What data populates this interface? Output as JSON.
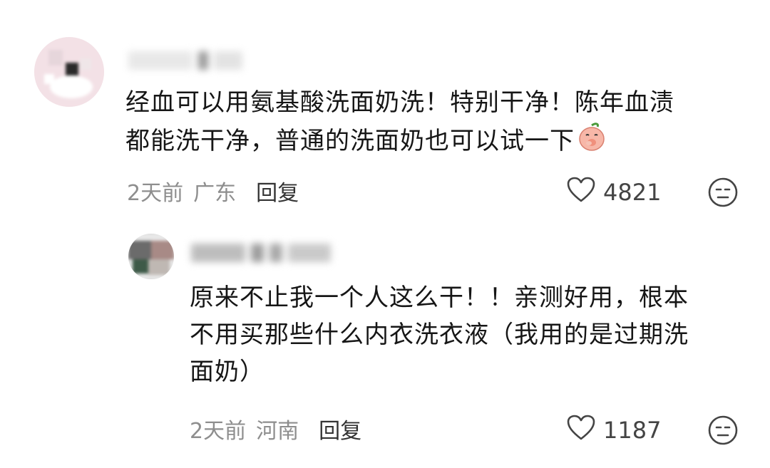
{
  "comments": [
    {
      "text_line1": "经血可以用氨基酸洗面奶洗！特别干净！陈年血渍",
      "text_line2": "都能洗干净，普通的洗面奶也可以试一下",
      "inline_emoji": "peach-cover-mouth-emoji",
      "time": "2天前",
      "location": "广东",
      "reply_label": "回复",
      "likes": "4821",
      "like_icon": "heart-outline-icon",
      "dislike_icon": "meh-face-icon"
    },
    {
      "text_line1": "原来不止我一个人这么干！！亲测好用，根本",
      "text_line2": "不用买那些什么内衣洗衣液（我用的是过期洗",
      "text_line3": "面奶）",
      "time": "2天前",
      "location": "河南",
      "reply_label": "回复",
      "likes": "1187",
      "like_icon": "heart-outline-icon",
      "dislike_icon": "meh-face-icon"
    }
  ],
  "colors": {
    "text": "#161616",
    "meta": "#8e8e8e",
    "reply": "#333333"
  }
}
